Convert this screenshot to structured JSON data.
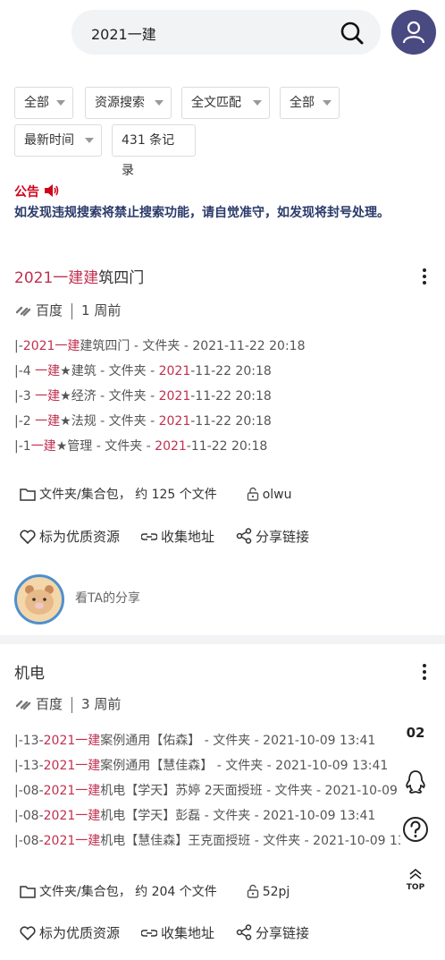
{
  "search": {
    "query": "2021一建"
  },
  "filters": {
    "row1": [
      "全部",
      "资源搜索",
      "全文匹配",
      "全部"
    ],
    "sort": "最新时间",
    "count": "431 条记录"
  },
  "notice": {
    "title": "公告",
    "body": "如发现违规搜索将禁止搜索功能，请自觉准守，如发现将封号处理。"
  },
  "results": [
    {
      "title_hl": "2021一建建",
      "title_rest": "筑四门",
      "source": "百度",
      "time": "1 周前",
      "files": [
        {
          "pre": "|-",
          "hl": "2021一建",
          "post": "建筑四门 - 文件夹 - 2021-11-22 20:18"
        },
        {
          "pre": "|-4 ",
          "hl": "一建",
          "post": "★建筑 - 文件夹 - ",
          "hl2": "2021",
          "post2": "-11-22 20:18"
        },
        {
          "pre": "|-3 ",
          "hl": "一建",
          "post": "★经济 - 文件夹 - ",
          "hl2": "2021",
          "post2": "-11-22 20:18"
        },
        {
          "pre": "|-2 ",
          "hl": "一建",
          "post": "★法规 - 文件夹 - ",
          "hl2": "2021",
          "post2": "-11-22 20:18"
        },
        {
          "pre": "|-1",
          "hl": "一建",
          "post": "★管理 - 文件夹 - ",
          "hl2": "2021",
          "post2": "-11-22 20:18"
        }
      ],
      "type": "文件夹/集合包",
      "size": "约 125 个文件",
      "code": "olwu",
      "action_like": "标为优质资源",
      "action_collect": "收集地址",
      "action_share": "分享链接",
      "sharer_label": "看TA的分享"
    },
    {
      "title_hl": "",
      "title_rest": "机电",
      "source": "百度",
      "time": "3 周前",
      "files": [
        {
          "pre": "|-13-",
          "hl": "2021一建",
          "post": "案例通用【佑森】 - 文件夹 - 2021-10-09 13:41"
        },
        {
          "pre": "|-13-",
          "hl": "2021一建",
          "post": "案例通用【慧佳森】 - 文件夹 - 2021-10-09 13:41"
        },
        {
          "pre": "|-08-",
          "hl": "2021一建",
          "post": "机电【学天】苏婷 2天面授班 - 文件夹 - 2021-10-09 13:41"
        },
        {
          "pre": "|-08-",
          "hl": "2021一建",
          "post": "机电【学天】彭磊 - 文件夹 - 2021-10-09 13:41"
        },
        {
          "pre": "|-08-",
          "hl": "2021一建",
          "post": "机电【慧佳森】王克面授班 - 文件夹 - 2021-10-09 13:41"
        }
      ],
      "type": "文件夹/集合包",
      "size": "约 204 个文件",
      "code": "52pj",
      "action_like": "标为优质资源",
      "action_collect": "收集地址",
      "action_share": "分享链接"
    }
  ],
  "side": {
    "page": "02",
    "top_label": "TOP"
  },
  "colors": {
    "highlight": "#c0304f",
    "notice": "#d0021b",
    "avatar_bg": "#4a4a82"
  }
}
